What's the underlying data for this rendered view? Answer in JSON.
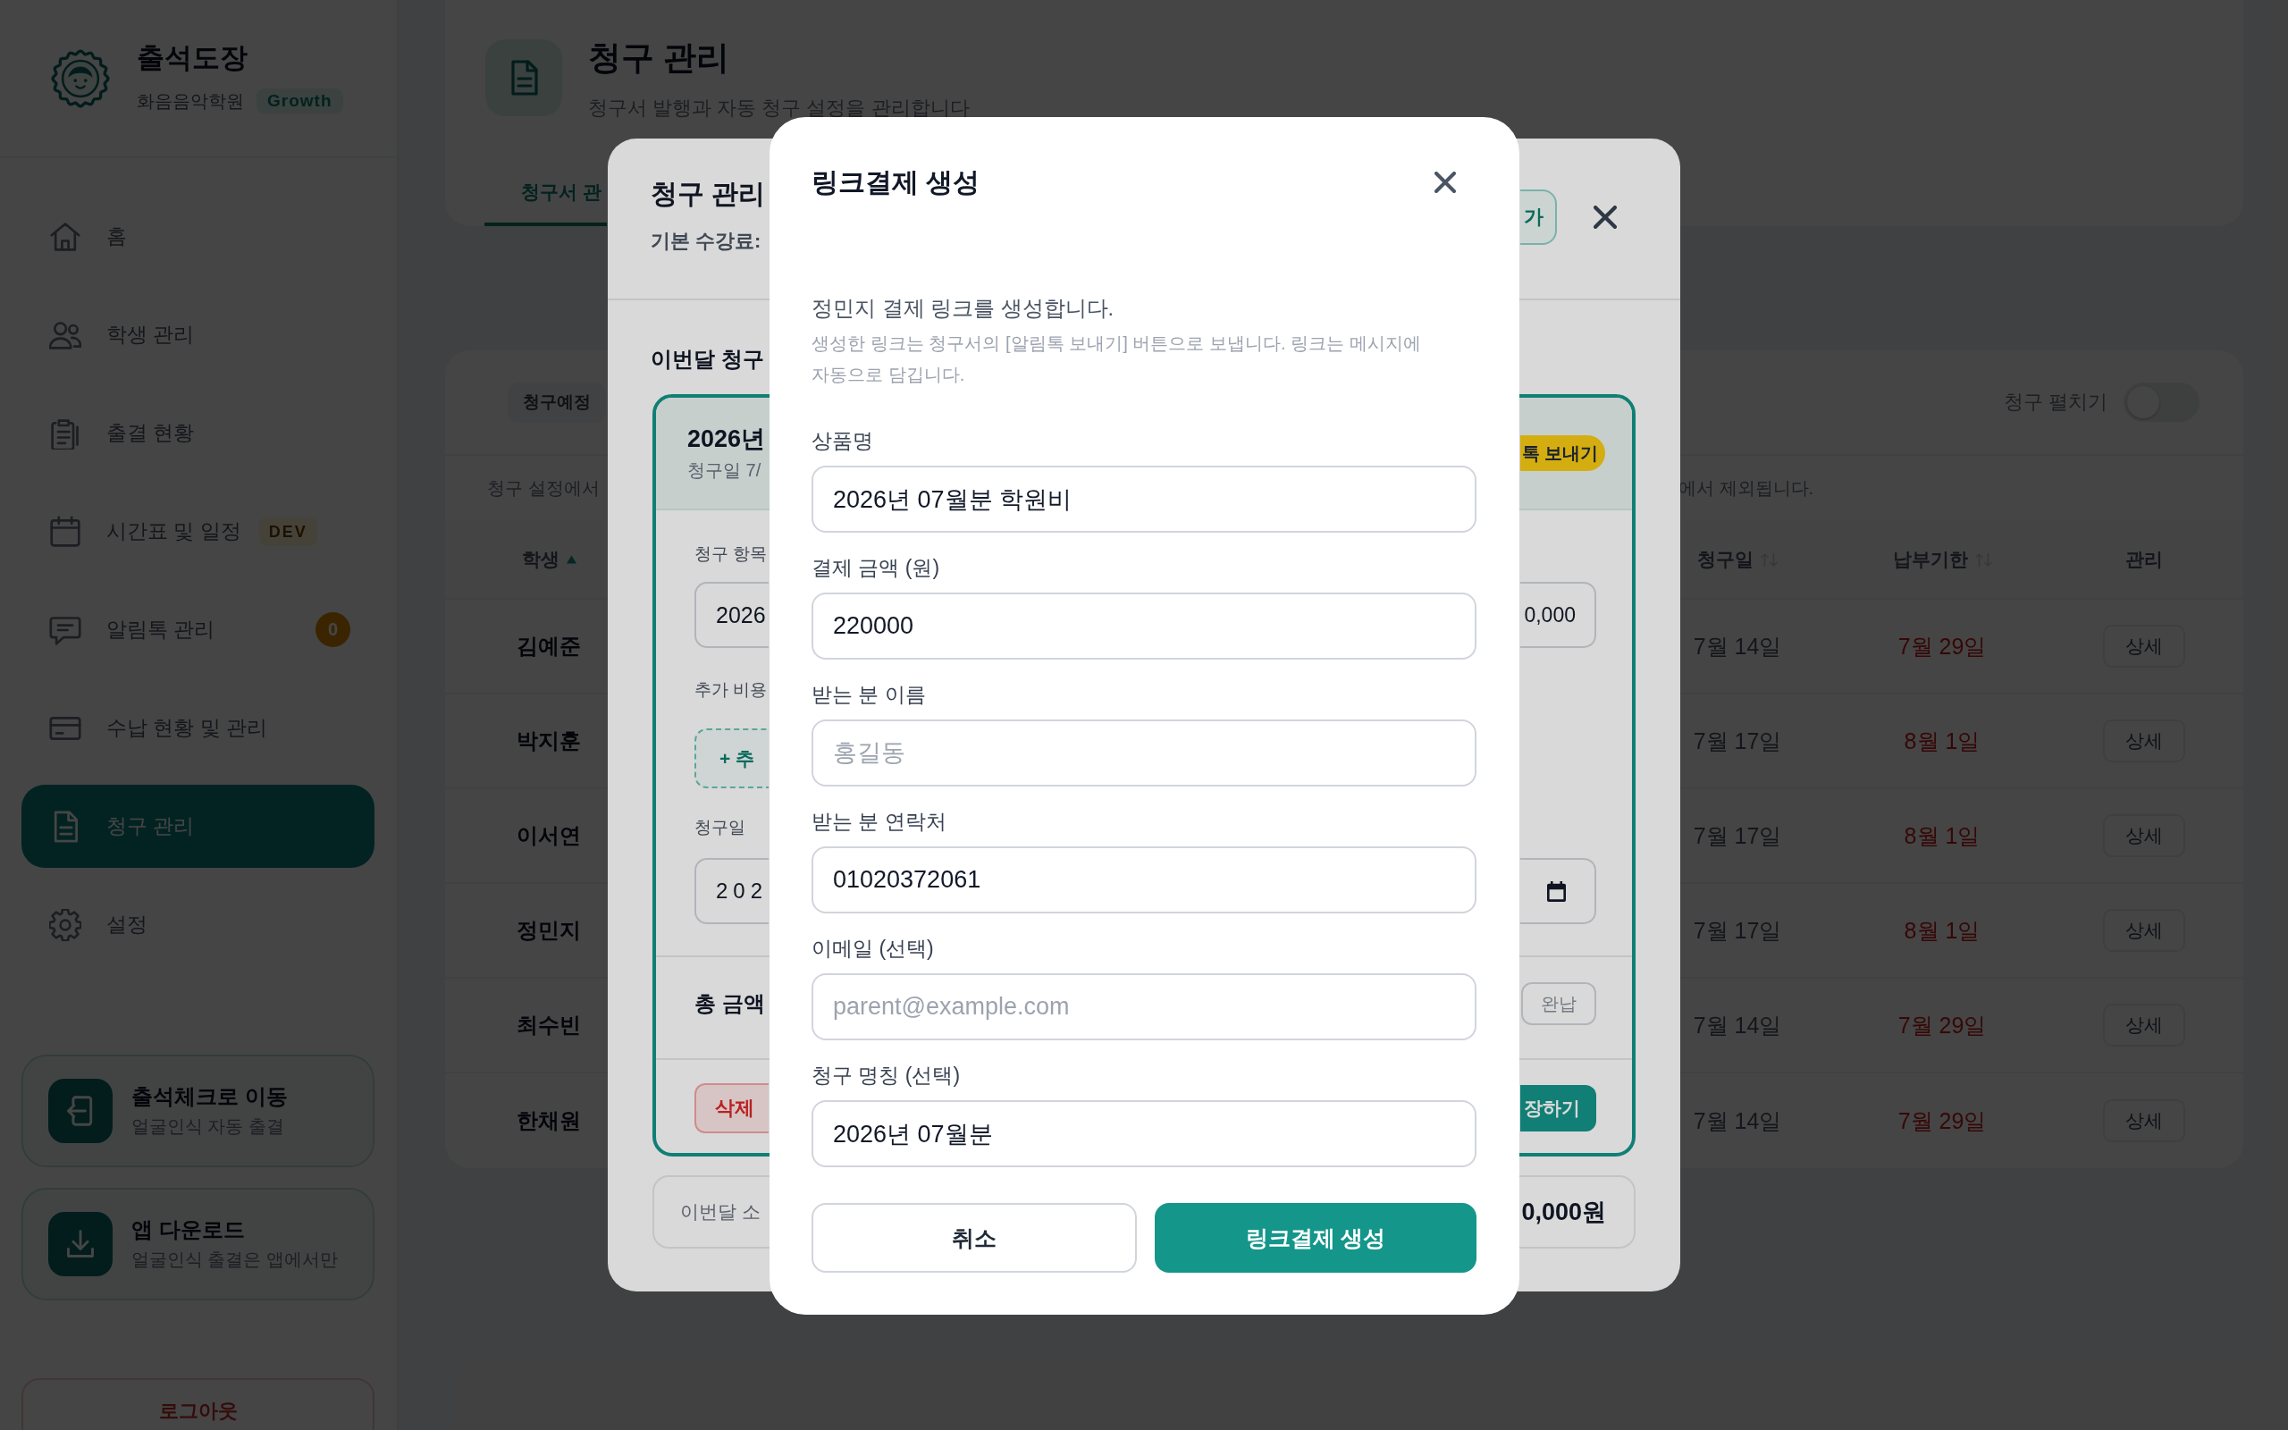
{
  "sidebar": {
    "brand": {
      "name": "출석도장",
      "academy": "화음음악학원",
      "plan": "Growth"
    },
    "nav": [
      {
        "label": "홈",
        "selected": false
      },
      {
        "label": "학생 관리",
        "selected": false
      },
      {
        "label": "출결 현황",
        "selected": false
      },
      {
        "label": "시간표 및 일정",
        "selected": false,
        "badge": {
          "kind": "tag",
          "text": "DEV"
        }
      },
      {
        "label": "알림톡 관리",
        "selected": false,
        "badge": {
          "kind": "count",
          "text": "0"
        }
      },
      {
        "label": "수납 현황 및 관리",
        "selected": false
      },
      {
        "label": "청구 관리",
        "selected": true
      },
      {
        "label": "설정",
        "selected": false
      }
    ],
    "shortcuts": [
      {
        "title": "출석체크로 이동",
        "subtitle": "얼굴인식 자동 출결"
      },
      {
        "title": "앱 다운로드",
        "subtitle": "얼굴인식 출결은 앱에서만"
      }
    ],
    "logout": "로그아웃"
  },
  "page_header": {
    "title": "청구 관리",
    "subtitle": "청구서 발행과 자동 청구 설정을 관리합니다",
    "tabs": [
      {
        "label": "청구서 관",
        "selected": true
      }
    ]
  },
  "billing_list": {
    "filter_chip": "청구예정",
    "expand_toggle": {
      "label": "청구 펼치기",
      "on": false
    },
    "notice_fragments": [
      "청구 설정에서",
      "에서 제외됩니다."
    ],
    "columns": [
      {
        "label": "학생",
        "sorted": true
      },
      {
        "label": "청구일",
        "sorted": false
      },
      {
        "label": "납부기한",
        "sorted": false
      },
      {
        "label": "관리"
      }
    ],
    "rows": [
      {
        "student": "김예준",
        "billing_date": "7월 14일",
        "due_date": "7월 29일",
        "action": "상세"
      },
      {
        "student": "박지훈",
        "billing_date": "7월 17일",
        "due_date": "8월 1일",
        "action": "상세"
      },
      {
        "student": "이서연",
        "billing_date": "7월 17일",
        "due_date": "8월 1일",
        "action": "상세"
      },
      {
        "student": "정민지",
        "billing_date": "7월 17일",
        "due_date": "8월 1일",
        "action": "상세"
      },
      {
        "student": "최수빈",
        "billing_date": "7월 14일",
        "due_date": "7월 29일",
        "action": "상세"
      },
      {
        "student": "한채원",
        "billing_date": "7월 14일",
        "due_date": "7월 29일",
        "action": "상세"
      }
    ]
  },
  "invoice_modal": {
    "title": "청구 관리",
    "base_fee_label": "기본 수강료:",
    "header_button": "가",
    "section_title": "이번달 청구",
    "invoice": {
      "title": "2026년",
      "date_line": "청구일 7/",
      "send_button": "톡 보내기",
      "item_label": "청구 항목",
      "item_name_value": "2026",
      "item_amount_value": "0,000",
      "extra_label": "추가 비용",
      "add_button": "+ 추",
      "date_label": "청구일",
      "date_value": "202",
      "total_label": "총 금액",
      "paid_button": "완납",
      "delete_button": "삭제",
      "save_button": "장하기"
    },
    "summary_label": "이번달 소",
    "summary_value": "0,000원"
  },
  "payment_link_modal": {
    "title": "링크결제 생성",
    "intro": "정민지 결제 링크를 생성합니다.",
    "help": "생성한 링크는 청구서의 [알림톡 보내기] 버튼으로 보냅니다. 링크는 메시지에 자동으로 담깁니다.",
    "fields": [
      {
        "label": "상품명",
        "value": "2026년 07월분 학원비"
      },
      {
        "label": "결제 금액 (원)",
        "value": "220000"
      },
      {
        "label": "받는 분 이름",
        "placeholder": "홍길동"
      },
      {
        "label": "받는 분 연락처",
        "value": "01020372061"
      },
      {
        "label": "이메일 (선택)",
        "placeholder": "parent@example.com"
      },
      {
        "label": "청구 명칭 (선택)",
        "value": "2026년 07월분"
      }
    ],
    "buttons": [
      {
        "label": "취소",
        "kind": "secondary"
      },
      {
        "label": "링크결제 생성",
        "kind": "primary"
      }
    ]
  }
}
